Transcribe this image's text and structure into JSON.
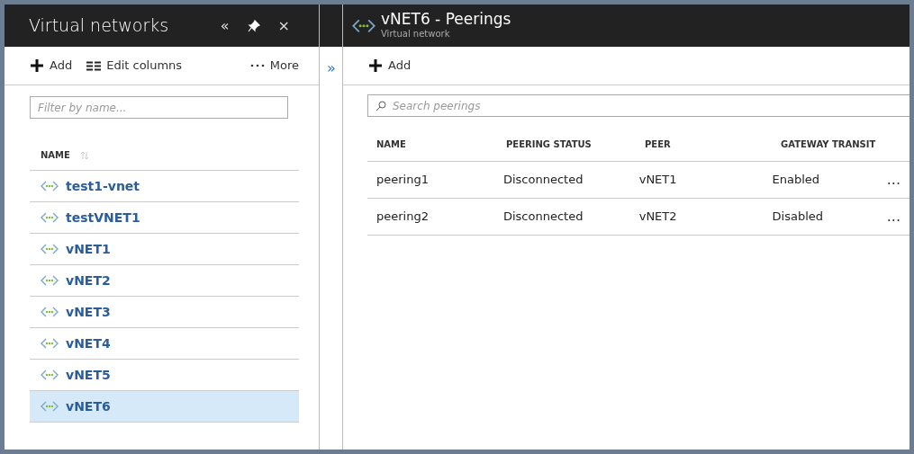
{
  "left_blade": {
    "title": "Virtual networks",
    "header_buttons": [
      "«",
      "×"
    ],
    "toolbar": [
      {
        "kind": "add",
        "label": "Add"
      },
      {
        "kind": "columns",
        "label": "Edit columns"
      },
      {
        "kind": "more",
        "label": "More"
      }
    ],
    "filter": {
      "placeholder": "Filter by name..."
    },
    "list_header": "NAME",
    "items": [
      {
        "label": "test1-vnet",
        "selected": false
      },
      {
        "label": "testVNET1",
        "selected": false
      },
      {
        "label": "vNET1",
        "selected": false
      },
      {
        "label": "vNET2",
        "selected": false
      },
      {
        "label": "vNET3",
        "selected": false
      },
      {
        "label": "vNET4",
        "selected": false
      },
      {
        "label": "vNET5",
        "selected": false
      },
      {
        "label": "vNET6",
        "selected": true
      }
    ]
  },
  "expand_glyph": "»",
  "right_blade": {
    "title": "vNET6 - Peerings",
    "subtitle": "Virtual network",
    "toolbar": [
      {
        "kind": "add",
        "label": "Add"
      }
    ],
    "search": {
      "placeholder": "Search peerings"
    },
    "table": {
      "columns": [
        "NAME",
        "PEERING STATUS",
        "PEER",
        "GATEWAY TRANSIT"
      ],
      "rows": [
        {
          "cells": [
            "peering1",
            "Disconnected",
            "vNET1",
            "Enabled"
          ],
          "menu": "..."
        },
        {
          "cells": [
            "peering2",
            "Disconnected",
            "vNET2",
            "Disabled"
          ],
          "menu": "..."
        }
      ]
    }
  }
}
